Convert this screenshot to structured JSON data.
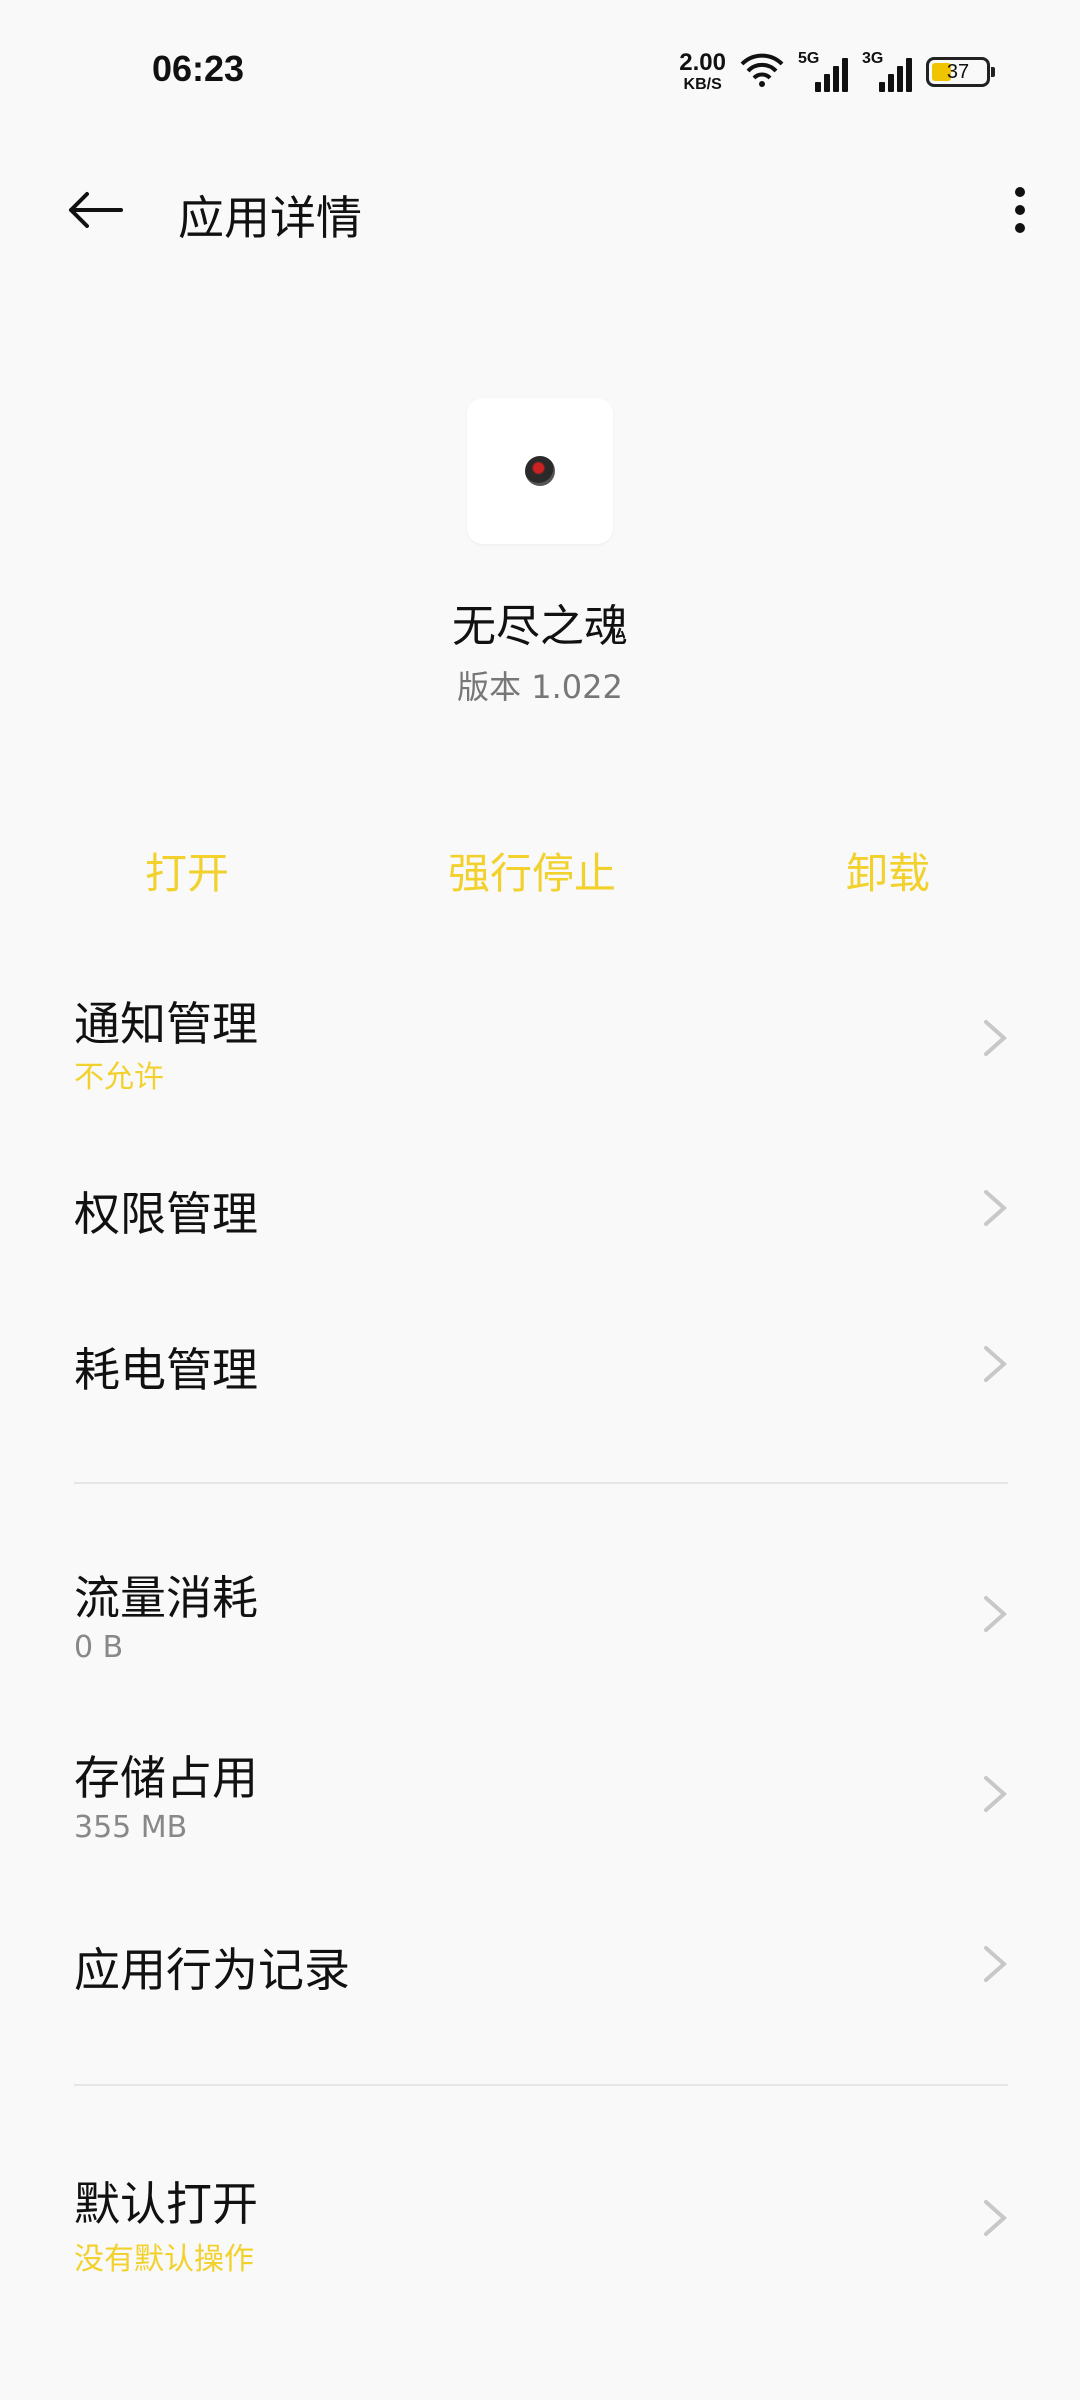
{
  "status_bar": {
    "time": "06:23",
    "net_speed_value": "2.00",
    "net_speed_unit": "KB/S",
    "sim1_label": "5G",
    "sim2_label": "3G",
    "battery_percent": "37",
    "battery_level": 0.37,
    "icons": [
      "wifi-icon",
      "signal-icon",
      "battery-icon"
    ]
  },
  "header": {
    "title": "应用详情",
    "back_icon": "back-arrow-icon",
    "more_icon": "more-vertical-icon"
  },
  "app": {
    "name": "无尽之魂",
    "version": "版本 1.022"
  },
  "actions": {
    "open": "打开",
    "force_stop": "强行停止",
    "uninstall": "卸载"
  },
  "rows": [
    {
      "title": "通知管理",
      "subtitle": "不允许"
    },
    {
      "title": "权限管理"
    },
    {
      "title": "耗电管理"
    },
    {
      "title": "流量消耗",
      "subtitle": "0 B"
    },
    {
      "title": "存储占用",
      "subtitle": "355 MB"
    },
    {
      "title": "应用行为记录"
    },
    {
      "title": "默认打开",
      "subtitle": "没有默认操作"
    }
  ],
  "colors": {
    "accent": "#f2d12c",
    "background": "#f9f9f9",
    "text": "#111111",
    "secondary_text": "#888888"
  }
}
